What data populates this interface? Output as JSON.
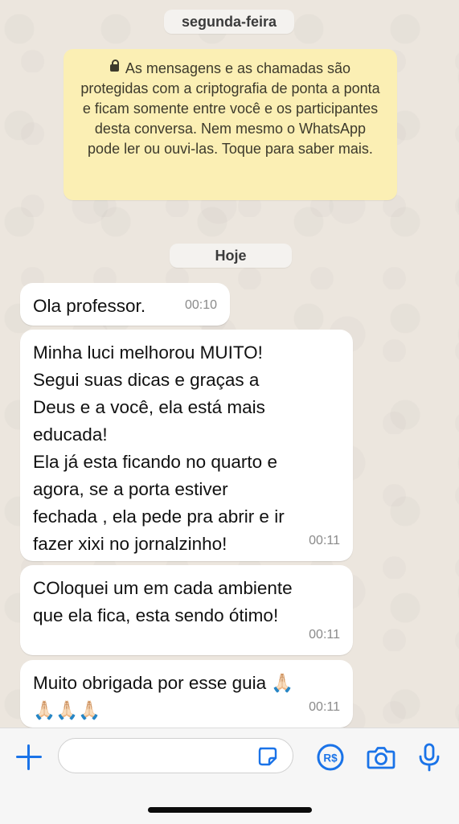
{
  "date_separators": {
    "monday": "segunda-feira",
    "today": "Hoje"
  },
  "encryption_notice": {
    "text": "As mensagens e as chamadas são protegidas com a criptografia de ponta a ponta e ficam somente entre você e os participantes desta conversa. Nem mesmo o WhatsApp pode ler ou ouvi-las. Toque para saber mais.",
    "icon": "lock-icon"
  },
  "messages": [
    {
      "text": "Ola professor.",
      "time": "00:10"
    },
    {
      "text": "Minha luci melhorou MUITO!\nSegui suas dicas e graças a\nDeus e a você, ela está mais\neducada!\nEla já esta ficando no quarto e\nagora, se a porta estiver\nfechada , ela pede pra abrir e ir\nfazer xixi no jornalzinho!",
      "time": "00:11"
    },
    {
      "text": "COloquei um em cada ambiente\nque ela fica, esta sendo ótimo!",
      "time": "00:11"
    },
    {
      "text": "Muito obrigada por esse guia 🙏🏻\n🙏🏻🙏🏻🙏🏻",
      "time": "00:11"
    }
  ],
  "composer": {
    "input_value": "",
    "icons": [
      "plus-icon",
      "sticker-icon",
      "pix-payment-icon",
      "camera-icon",
      "microphone-icon"
    ]
  },
  "colors": {
    "accent": "#1a73e8",
    "notice_bg": "#fbefb4",
    "bubble_bg": "#ffffff",
    "chat_bg": "#ece6de"
  }
}
